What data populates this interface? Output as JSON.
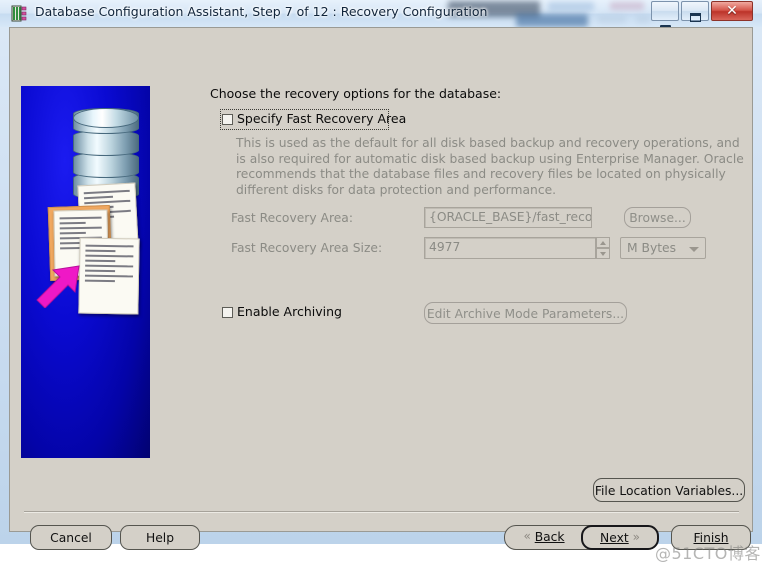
{
  "window": {
    "title": "Database Configuration Assistant, Step 7 of 12 : Recovery Configuration",
    "app_icon": "database-icon",
    "controls": {
      "minimize": "minimize-button",
      "maximize": "maximize-button",
      "close_glyph": "✕"
    }
  },
  "illustration": {
    "name": "database-recovery-illustration",
    "background_color": "#0a0ad2",
    "arrow_color": "#ef18c6"
  },
  "main": {
    "heading": "Choose the recovery options for the database:",
    "specify_fra": {
      "label": "Specify Fast Recovery Area",
      "checked": false,
      "focused": true
    },
    "description": "This is used as the default for all disk based backup and recovery operations, and is also required for automatic disk based backup using Enterprise Manager. Oracle recommends that the database files and recovery files be located on physically different disks for data protection and performance.",
    "fields": [
      {
        "label": "Fast Recovery Area:",
        "value": "{ORACLE_BASE}/fast_recovery_a",
        "enabled": false
      },
      {
        "label": "Fast Recovery Area Size:",
        "value": "4977",
        "enabled": false
      }
    ],
    "browse_button": "Browse...",
    "size_unit": "M Bytes",
    "enable_archiving": {
      "label": "Enable Archiving",
      "checked": false
    },
    "edit_archive_button": "Edit Archive Mode Parameters...",
    "file_location_button": "File Location Variables..."
  },
  "footer": {
    "cancel": "Cancel",
    "help": "Help",
    "back": "Back",
    "next": "Next",
    "finish": "Finish",
    "back_chevron": "«",
    "next_chevron": "»"
  },
  "watermark": "@51CTO博客"
}
